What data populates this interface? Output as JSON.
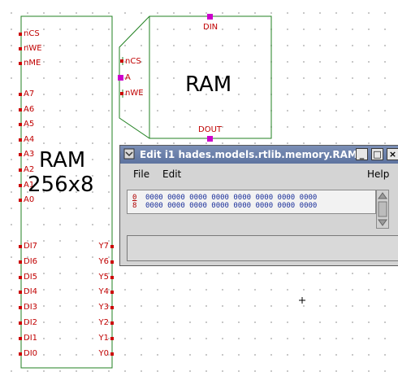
{
  "ram1": {
    "title_line1": "RAM",
    "title_line2": "256x8",
    "inputs_top": [
      "nCS",
      "nWE",
      "nME"
    ],
    "addr_pins": [
      "A7",
      "A6",
      "A5",
      "A4",
      "A3",
      "A2",
      "A1",
      "A0"
    ],
    "data_in_pins": [
      "DI7",
      "DI6",
      "DI5",
      "DI4",
      "DI3",
      "DI2",
      "DI1",
      "DI0"
    ],
    "data_out_pins": [
      "Y7",
      "Y6",
      "Y5",
      "Y4",
      "Y3",
      "Y2",
      "Y1",
      "Y0"
    ]
  },
  "ram2": {
    "title": "RAM",
    "din": "DIN",
    "dout": "DOUT",
    "ncs": "nCS",
    "a": "A",
    "nwe": "nWE"
  },
  "editor": {
    "title": "Edit i1 hades.models.rtlib.memory.RAM",
    "menu": {
      "file": "File",
      "edit": "Edit",
      "help": "Help"
    },
    "buttons": {
      "minimize": "_",
      "maximize": "□",
      "close": "×"
    },
    "rows": [
      {
        "addr": "0",
        "values": "0000 0000 0000 0000 0000 0000 0000 0000"
      },
      {
        "addr": "8",
        "values": "0000 0000 0000 0000 0000 0000 0000 0000"
      }
    ]
  },
  "colors": {
    "wire": "#208020",
    "pin": "#cc0000",
    "magenta_pin": "#cc00cc",
    "titlebar": "#6b80ab"
  }
}
